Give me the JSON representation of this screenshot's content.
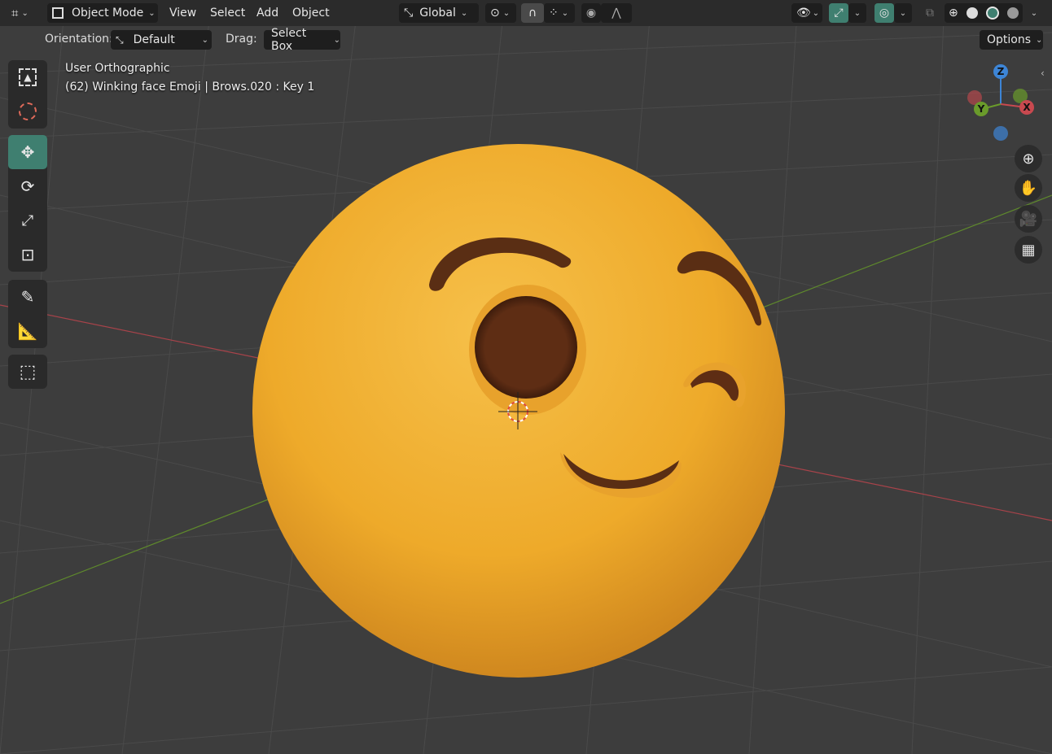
{
  "header": {
    "mode_label": "Object Mode",
    "menus": [
      "View",
      "Select",
      "Add",
      "Object"
    ],
    "transform_orientation": "Global",
    "options_label": "Options"
  },
  "tool_settings": {
    "orientation_label": "Orientation:",
    "orientation_value": "Default",
    "drag_label": "Drag:",
    "drag_value": "Select Box"
  },
  "viewport": {
    "view_name": "User Orthographic",
    "object_info": "(62) Winking face Emoji | Brows.020 : Key 1"
  },
  "gizmo": {
    "z": "Z",
    "y": "Y",
    "x": "X"
  },
  "colors": {
    "header_bg": "#2b2b2b",
    "viewport_bg": "#3d3d3d",
    "active_tool": "#3f7f70",
    "emoji_yellow": "#f2b533",
    "feature_brown": "#5a2e14",
    "axis_x": "#c8494f",
    "axis_y": "#6a9b2b",
    "axis_z": "#3d85d6"
  },
  "icons": [
    "editor-type-icon",
    "object-mode-icon",
    "transform-orientation-icon",
    "pivot-icon",
    "snap-icon",
    "snap-increment-icon",
    "proportional-edit-icon",
    "falloff-icon",
    "visibility-icon",
    "gizmo-icon",
    "overlay-icon",
    "xray-icon",
    "wireframe-shading-icon",
    "solid-shading-icon",
    "material-shading-icon",
    "rendered-shading-icon",
    "select-box-icon",
    "cursor-icon",
    "move-icon",
    "rotate-icon",
    "scale-icon",
    "transform-icon",
    "annotate-icon",
    "measure-icon",
    "add-cube-icon",
    "zoom-icon",
    "pan-hand-icon",
    "camera-icon",
    "grid-icon"
  ]
}
